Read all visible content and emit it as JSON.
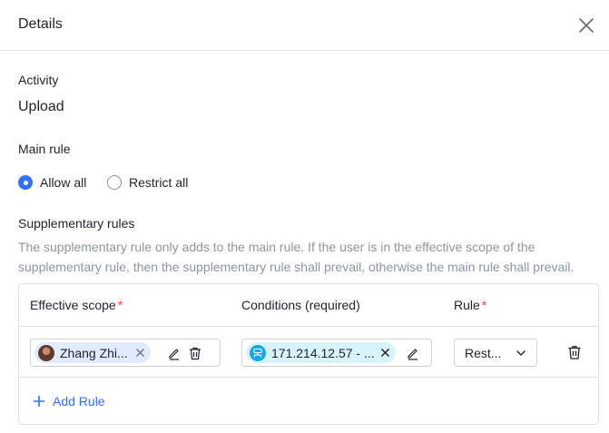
{
  "dialog": {
    "title": "Details"
  },
  "activity": {
    "label": "Activity",
    "value": "Upload"
  },
  "main_rule": {
    "label": "Main rule",
    "options": [
      {
        "label": "Allow all",
        "checked": true
      },
      {
        "label": "Restrict all",
        "checked": false
      }
    ]
  },
  "supplementary": {
    "label": "Supplementary rules",
    "description": "The supplementary rule only adds to the main rule. If the user is in the effective scope of the supplementary rule, then the supplementary rule shall prevail, otherwise the main rule shall prevail.",
    "columns": {
      "scope": "Effective scope",
      "conditions": "Conditions (required)",
      "rule": "Rule",
      "required_mark": "*"
    },
    "rows": [
      {
        "scope_tag": "Zhang Zhi...",
        "condition_tag": "171.214.12.57 - ...",
        "rule_value": "Rest..."
      }
    ],
    "add_label": "Add Rule"
  },
  "colors": {
    "accent": "#3370ff",
    "required": "#f54a45",
    "muted_text": "#8f959e",
    "user_tag_bg": "#e1eaff",
    "ip_tag_bg": "#d9f3fd",
    "ip_icon": "#14a9e8"
  },
  "icons": [
    "close-icon",
    "edit-icon",
    "trash-icon",
    "chevron-down-icon",
    "plus-icon",
    "ip-icon"
  ]
}
